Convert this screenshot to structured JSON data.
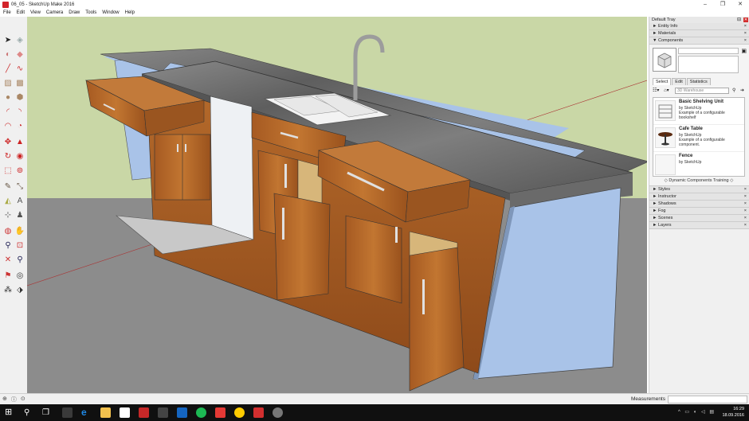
{
  "window": {
    "title": "06_05 - SketchUp Make 2016",
    "controls": [
      "–",
      "❐",
      "✕"
    ]
  },
  "menu": [
    "File",
    "Edit",
    "View",
    "Camera",
    "Draw",
    "Tools",
    "Window",
    "Help"
  ],
  "tray": {
    "title": "Default Tray",
    "sections_top": [
      "Entity Info",
      "Materials",
      "Components"
    ],
    "tabs": [
      "Select",
      "Edit",
      "Statistics"
    ],
    "search_placeholder": "3D Warehouse",
    "components": [
      {
        "name": "Basic Shelving Unit",
        "by": "by SketchUp",
        "desc": "Example of a configurable bookshelf"
      },
      {
        "name": "Cafe Table",
        "by": "by SketchUp",
        "desc": "Example of a configurable component."
      },
      {
        "name": "Fence",
        "by": "by SketchUp",
        "desc": ""
      }
    ],
    "training_link": "Dynamic Components Training",
    "sections_bottom": [
      "Styles",
      "Instructor",
      "Shadows",
      "Fog",
      "Scenes",
      "Layers"
    ]
  },
  "status": {
    "measurements_label": "Measurements"
  },
  "taskbar": {
    "time": "16:29",
    "date": "18.09.2016"
  },
  "colors": {
    "sky": "#c9d7a6",
    "ground": "#8c8c8c",
    "wood": "#b8682a",
    "counter": "#6e6e6e",
    "panel": "#a9c3e8",
    "accent_red": "#d32f2f"
  },
  "icons": {
    "toolbar": [
      "select-icon",
      "eraser-icon",
      "paint-bucket-icon",
      "eraser-alt-icon",
      "line-icon",
      "freehand-icon",
      "rectangle-icon",
      "rotated-rectangle-icon",
      "circle-icon",
      "polygon-icon",
      "arc-icon",
      "pie-icon",
      "move-icon",
      "push-pull-icon",
      "rotate-icon",
      "follow-me-icon",
      "scale-icon",
      "offset-icon",
      "tape-measure-icon",
      "dimension-icon",
      "protractor-icon",
      "text-icon",
      "axes-icon",
      "3d-text-icon",
      "orbit-icon",
      "pan-icon",
      "zoom-icon",
      "zoom-window-icon",
      "zoom-extents-icon",
      "walk-icon",
      "position-camera-icon",
      "look-around-icon",
      "section-plane-icon"
    ]
  }
}
